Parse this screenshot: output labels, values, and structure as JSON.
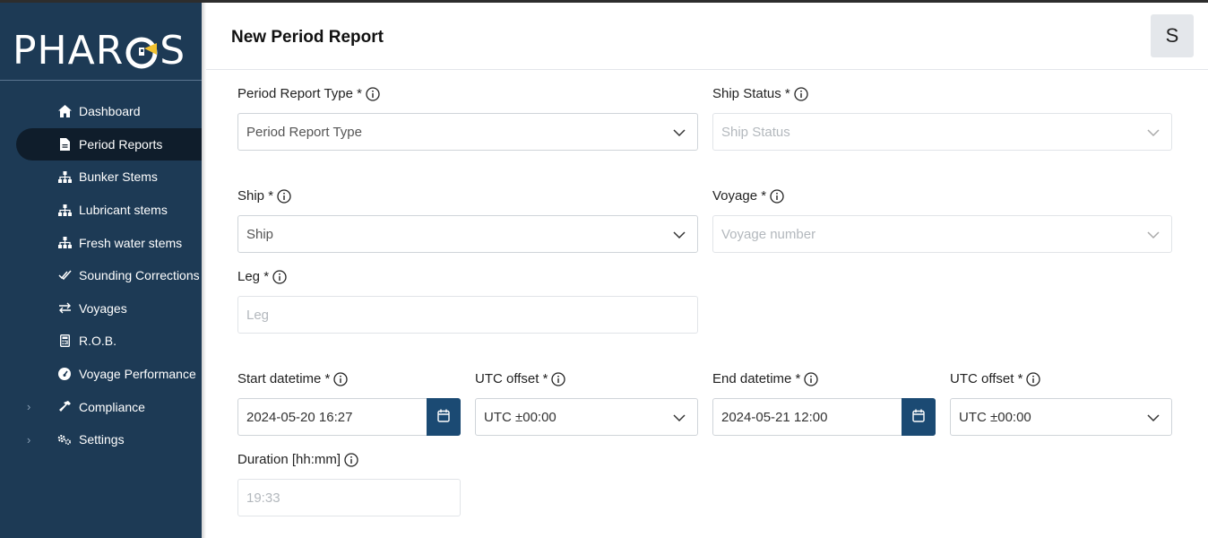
{
  "app": {
    "logo_text": "PHAROS"
  },
  "sidebar": {
    "items": [
      {
        "label": "Dashboard",
        "icon": "home-icon"
      },
      {
        "label": "Period Reports",
        "icon": "document-icon",
        "active": true
      },
      {
        "label": "Bunker Stems",
        "icon": "sitemap-icon"
      },
      {
        "label": "Lubricant stems",
        "icon": "sitemap-icon"
      },
      {
        "label": "Fresh water stems",
        "icon": "sitemap-icon"
      },
      {
        "label": "Sounding Corrections",
        "icon": "double-check-icon"
      },
      {
        "label": "Voyages",
        "icon": "swap-arrows-icon"
      },
      {
        "label": "R.O.B.",
        "icon": "calculator-icon"
      },
      {
        "label": "Voyage Performance",
        "icon": "gauge-icon"
      },
      {
        "label": "Compliance",
        "icon": "hammer-icon",
        "expandable": true
      },
      {
        "label": "Settings",
        "icon": "cogs-icon",
        "expandable": true
      }
    ]
  },
  "header": {
    "title": "New Period Report",
    "avatar_initial": "S"
  },
  "form": {
    "period_report_type": {
      "label": "Period Report Type *",
      "placeholder": "Period Report Type"
    },
    "ship_status": {
      "label": "Ship Status *",
      "placeholder": "Ship Status"
    },
    "ship": {
      "label": "Ship *",
      "placeholder": "Ship"
    },
    "voyage": {
      "label": "Voyage *",
      "placeholder": "Voyage number"
    },
    "leg": {
      "label": "Leg *",
      "placeholder": "Leg"
    },
    "start_datetime": {
      "label": "Start datetime *",
      "value": "2024-05-20 16:27"
    },
    "start_utc_offset": {
      "label": "UTC offset *",
      "value": "UTC ±00:00"
    },
    "end_datetime": {
      "label": "End datetime *",
      "value": "2024-05-21 12:00"
    },
    "end_utc_offset": {
      "label": "UTC offset *",
      "value": "UTC ±00:00"
    },
    "duration": {
      "label": "Duration [hh:mm]",
      "value": "19:33"
    }
  },
  "colors": {
    "sidebar_bg": "#1d3a55",
    "active_item_bg": "#0f1d2b",
    "accent": "#1b4a73"
  }
}
